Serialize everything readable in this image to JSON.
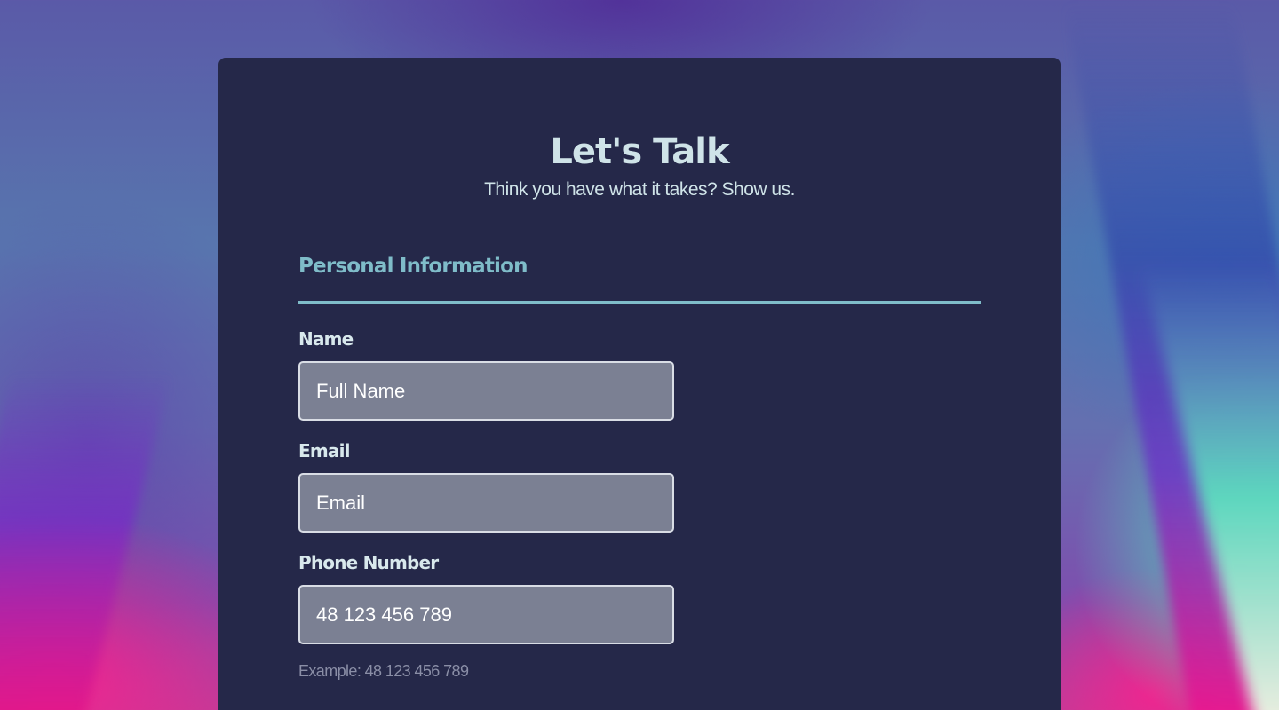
{
  "header": {
    "title": "Let's Talk",
    "subtitle": "Think you have what it takes? Show us."
  },
  "section": {
    "title": "Personal Information"
  },
  "fields": {
    "name": {
      "label": "Name",
      "placeholder": "Full Name",
      "value": ""
    },
    "email": {
      "label": "Email",
      "placeholder": "Email",
      "value": ""
    },
    "phone": {
      "label": "Phone Number",
      "placeholder": "48 123 456 789",
      "value": "",
      "hint": "Example: 48 123 456 789"
    }
  },
  "colors": {
    "card_background": "#252849",
    "title_text": "#cfe3e8",
    "section_accent": "#7fbcc9",
    "input_background": "#7b8093",
    "input_border": "#d9dde5",
    "hint_text": "#8a8ea6"
  }
}
